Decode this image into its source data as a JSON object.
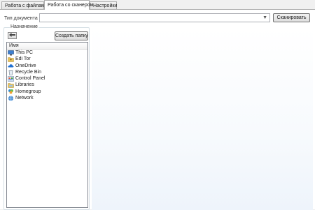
{
  "tabs": [
    {
      "label": "Работа с файлами",
      "active": false
    },
    {
      "label": "Работа со сканером",
      "active": true
    },
    {
      "label": "Настройки",
      "active": false
    }
  ],
  "doc_type": {
    "label": "Тип документа",
    "value": ""
  },
  "scan_button": "Сканировать",
  "destination": {
    "legend": "Назначение",
    "back_icon": "arrow-left-icon",
    "new_folder_button": "Создать папку",
    "column_header": "Имя",
    "items": [
      {
        "label": "This PC",
        "icon": "computer-icon"
      },
      {
        "label": "Edi Tor",
        "icon": "user-folder-icon"
      },
      {
        "label": "OneDrive",
        "icon": "cloud-icon"
      },
      {
        "label": "Recycle Bin",
        "icon": "recycle-bin-icon"
      },
      {
        "label": "Control Panel",
        "icon": "control-panel-icon"
      },
      {
        "label": "Libraries",
        "icon": "libraries-icon"
      },
      {
        "label": "Homegroup",
        "icon": "homegroup-icon"
      },
      {
        "label": "Network",
        "icon": "network-icon"
      }
    ]
  }
}
